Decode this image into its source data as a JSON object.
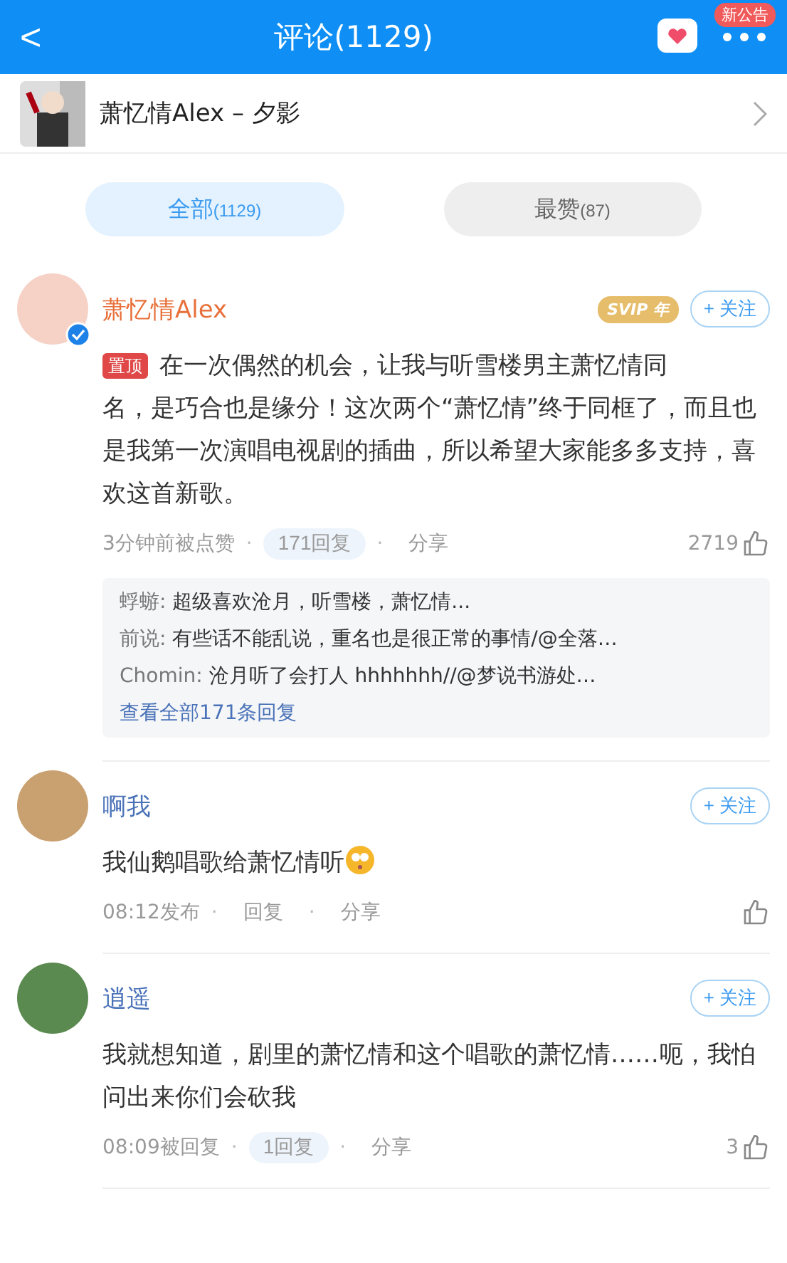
{
  "header": {
    "back": "<",
    "title": "评论(1129)",
    "badge": "新公告"
  },
  "song": {
    "title": "萧忆情Alex – 夕影"
  },
  "sep": "·",
  "tabs": [
    {
      "label": "全部",
      "count": "(1129)",
      "selected": true
    },
    {
      "label": "最赞",
      "count": "(87)",
      "selected": false
    }
  ],
  "comments": [
    {
      "user": "萧忆情Alex",
      "vip": "SVIP 年",
      "verified": true,
      "pinned": "置顶",
      "follow": "+ 关注",
      "lead": "在一次偶然的机会，让我与听雪楼男主萧忆情同",
      "text": "名，是巧合也是缘分！这次两个“萧忆情”终于同框了，而且也是我第一次演唱电视剧的插曲，所以希望大家能多多支持，喜欢这首新歌。",
      "time": "3分钟前被点赞",
      "reply": "171回复",
      "share": "分享",
      "likes": "2719",
      "replies": [
        {
          "user": "蜉蝣:",
          "text": "超级喜欢沧月，听雪楼，萧忆情..."
        },
        {
          "user": "前说:",
          "text": "有些话不能乱说，重名也是很正常的事情/@全落…"
        },
        {
          "user": "Chomin:",
          "text": "沧月听了会打人 hhhhhhh//@梦说书游处…"
        }
      ],
      "more": "查看全部171条回复"
    },
    {
      "user": "啊我",
      "follow": "+ 关注",
      "text": "我仙鹅唱歌给萧忆情听",
      "emoji": true,
      "time": "08:12发布",
      "reply": "回复",
      "share": "分享"
    },
    {
      "user": "逍遥",
      "follow": "+ 关注",
      "text": "我就想知道，剧里的萧忆情和这个唱歌的萧忆情……呃，我怕问出来你们会砍我",
      "time": "08:09被回复",
      "reply": "1回复",
      "share": "分享",
      "likes": "3"
    }
  ]
}
